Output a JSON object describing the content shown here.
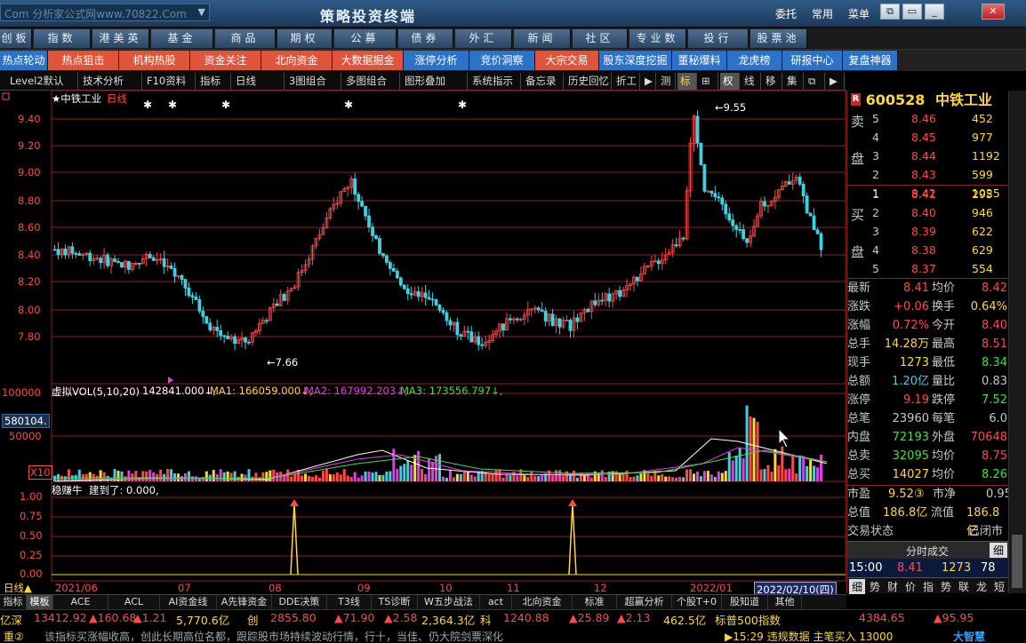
{
  "title_bar": {
    "search_text": "Com  分析家公式网www.70822.Com",
    "app_title": "策略投资终端",
    "menu": [
      "委托",
      "常用",
      "菜单"
    ],
    "win_buttons": [
      "⧉",
      "▭",
      "_",
      "✕"
    ]
  },
  "menubar": [
    "创板",
    "指数",
    "港美英",
    "基金",
    "商品",
    "期权",
    "公募REITs",
    "债券",
    "外汇",
    "新闻",
    "社区",
    "专业数据",
    "投行",
    "股票池"
  ],
  "tabbar": [
    {
      "label": "热点轮动",
      "color": "#2b73c9"
    },
    {
      "label": "热点狙击",
      "color": "#e0553a"
    },
    {
      "label": "机构热股",
      "color": "#e0553a"
    },
    {
      "label": "资金关注",
      "color": "#e0553a"
    },
    {
      "label": "北向资金",
      "color": "#e0553a"
    },
    {
      "label": "大数据掘金",
      "color": "#e0553a"
    },
    {
      "label": "涨停分析",
      "color": "#2b73c9"
    },
    {
      "label": "竞价洞察",
      "color": "#2b73c9"
    },
    {
      "label": "大宗交易",
      "color": "#e0553a"
    },
    {
      "label": "股东深度挖掘",
      "color": "#2b73c9"
    },
    {
      "label": "董秘爆料",
      "color": "#2b73c9"
    },
    {
      "label": "龙虎榜",
      "color": "#2b73c9"
    },
    {
      "label": "研报中心",
      "color": "#2b73c9"
    },
    {
      "label": "复盘神器",
      "color": "#2b73c9"
    }
  ],
  "toolbar": [
    "Level2默认",
    "技术分析",
    "F10资料",
    "指标",
    "日线",
    "3图组合",
    "多图组合",
    "图形叠加",
    "系统指示",
    "备忘录",
    "历史回忆",
    "折工",
    "▶",
    "测",
    "标",
    "⊞",
    "权",
    "线",
    "移",
    "集",
    "⧉",
    "▶"
  ],
  "chart": {
    "stock_label": "★中铁工业",
    "period_label": "日线",
    "price_ticks": [
      "9.40",
      "9.20",
      "9.00",
      "8.80",
      "8.60",
      "8.40",
      "8.20",
      "8.00",
      "7.80"
    ],
    "high_marker": "9.55",
    "low_marker": "7.66",
    "vol_header": "虚拟VOL(5,10,20)",
    "vol_value": "142841.000↓,",
    "ma1": "MA1: 166059.000↓,",
    "ma2": "MA2: 167992.203↓,",
    "ma3": "MA3: 173556.797↓,",
    "vol_ticks": [
      "100000",
      "50000"
    ],
    "vol_box": "580104.",
    "vol_mult": "X10",
    "ind_name": "稳赚牛",
    "ind_text": "建到了: 0.000,",
    "ind_ticks": [
      "1.00",
      "0.75",
      "0.50",
      "0.25",
      "0.00"
    ],
    "period_bottom": "日线▲",
    "dates": [
      "2021/06",
      "07",
      "08",
      "09",
      "10",
      "11",
      "12",
      "2022/01"
    ],
    "date_box": "2022/02/10(四)",
    "colors": {
      "up": "#ff4a4a",
      "down": "#40d0e0",
      "grid": "#8a2020",
      "ma1": "#ffffff",
      "ma2": "#e040e0",
      "ma3": "#40e040"
    }
  },
  "chart_data": {
    "type": "candlestick",
    "title": "中铁工业",
    "ylim": [
      7.6,
      9.6
    ],
    "x_labels": [
      "2021/06",
      "07",
      "08",
      "09",
      "10",
      "11",
      "12",
      "2022/01",
      "2022/02/10"
    ],
    "high": 9.55,
    "low": 7.66,
    "close_last": 8.41,
    "grid": true
  },
  "right_panel": {
    "code": "600528",
    "name": "中铁工业",
    "sell_label": [
      "卖",
      "盘"
    ],
    "buy_label": [
      "买",
      "盘"
    ],
    "sell": [
      {
        "lvl": "5",
        "price": "8.46",
        "vol": "452"
      },
      {
        "lvl": "4",
        "price": "8.45",
        "vol": "977"
      },
      {
        "lvl": "3",
        "price": "8.44",
        "vol": "1192"
      },
      {
        "lvl": "2",
        "price": "8.43",
        "vol": "599"
      },
      {
        "lvl": "1",
        "price": "8.42",
        "vol": "1025"
      }
    ],
    "buy": [
      {
        "lvl": "1",
        "price": "8.41",
        "vol": "295"
      },
      {
        "lvl": "2",
        "price": "8.40",
        "vol": "946"
      },
      {
        "lvl": "3",
        "price": "8.39",
        "vol": "622"
      },
      {
        "lvl": "4",
        "price": "8.38",
        "vol": "629"
      },
      {
        "lvl": "5",
        "price": "8.37",
        "vol": "554"
      }
    ],
    "quotes": [
      {
        "k1": "最新",
        "v1": "8.41",
        "c1": "#ff4a4a",
        "k2": "均价",
        "v2": "8.42",
        "c2": "#ff4a4a"
      },
      {
        "k1": "涨跌",
        "v1": "+0.06",
        "c1": "#ff4a4a",
        "k2": "换手",
        "v2": "0.64%",
        "c2": "#ffd83a"
      },
      {
        "k1": "涨幅",
        "v1": "0.72%",
        "c1": "#ff4a4a",
        "k2": "今开",
        "v2": "8.40",
        "c2": "#ff4a4a"
      },
      {
        "k1": "总手",
        "v1": "14.28万",
        "c1": "#ffd83a",
        "k2": "最高",
        "v2": "8.51",
        "c2": "#ff4a4a"
      },
      {
        "k1": "现手",
        "v1": "1273",
        "c1": "#ffd83a",
        "k2": "最低",
        "v2": "8.34",
        "c2": "#40e040"
      },
      {
        "k1": "总额",
        "v1": "1.20亿",
        "c1": "#40d0e0",
        "k2": "量比",
        "v2": "0.83",
        "c2": "#c8c8c8"
      },
      {
        "k1": "涨停",
        "v1": "9.19",
        "c1": "#ff4a4a",
        "k2": "跌停",
        "v2": "7.52",
        "c2": "#40e040"
      },
      {
        "k1": "总笔",
        "v1": "23960",
        "c1": "#c8c8c8",
        "k2": "每笔",
        "v2": "6.0",
        "c2": "#c8c8c8"
      },
      {
        "k1": "内盘",
        "v1": "72193",
        "c1": "#40e040",
        "k2": "外盘",
        "v2": "70648",
        "c2": "#ff4a4a"
      },
      {
        "k1": "总卖",
        "v1": "32095",
        "c1": "#40e040",
        "k2": "均价",
        "v2": "8.75",
        "c2": "#ff4a4a"
      },
      {
        "k1": "总买",
        "v1": "14027",
        "c1": "#ffd83a",
        "k2": "均价",
        "v2": "8.26",
        "c2": "#40e040"
      }
    ],
    "pe": {
      "k1": "市盈",
      "v1": "9.52③",
      "k2": "市净",
      "v2": "0.95"
    },
    "cap": {
      "k1": "总值",
      "v1": "186.8亿",
      "k2": "流值",
      "v2": "186.8亿"
    },
    "status": {
      "k": "交易状态",
      "v": "已闭市"
    },
    "trades_tab": "分时成交",
    "detail_tab": "细",
    "trade": {
      "time": "15:00",
      "price": "8.41",
      "vol": "1273",
      "n": "78"
    },
    "bottom_tabs": [
      "细",
      "势",
      "财",
      "价",
      "指",
      "势",
      "联",
      "龙",
      "短"
    ]
  },
  "bottom_bar": [
    "指标",
    "模板",
    "ACE",
    "ACL",
    "AI资金线",
    "A先锋资金",
    "DDE决策",
    "T3线",
    "TS诊断",
    "W五步战法",
    "act",
    "北向资金",
    "标准",
    "超赢分析",
    "个股T+0",
    "股知道",
    "其他"
  ],
  "ticker": [
    {
      "t": "亿深",
      "c": "#ffd83a"
    },
    {
      "t": "13412.92",
      "c": "#ff4a4a"
    },
    {
      "t": "▲160.68",
      "c": "#ff4a4a"
    },
    {
      "t": "▲1.21",
      "c": "#ff4a4a"
    },
    {
      "t": "5,770.6亿",
      "c": "#ffd83a"
    },
    {
      "t": "创",
      "c": "#ffd83a"
    },
    {
      "t": "2855.80",
      "c": "#ff4a4a"
    },
    {
      "t": "▲71.90",
      "c": "#ff4a4a"
    },
    {
      "t": "▲2.58",
      "c": "#ff4a4a"
    },
    {
      "t": "2,364.3亿",
      "c": "#ffd83a"
    },
    {
      "t": "科",
      "c": "#ffd83a"
    },
    {
      "t": "1240.88",
      "c": "#ff4a4a"
    },
    {
      "t": "▲25.89",
      "c": "#ff4a4a"
    },
    {
      "t": "▲2.13",
      "c": "#ff4a4a"
    },
    {
      "t": "462.5亿",
      "c": "#ffd83a"
    },
    {
      "t": "标普500指数",
      "c": "#ffd83a"
    },
    {
      "t": "4384.65",
      "c": "#ff4a4a"
    },
    {
      "t": "▲95.95",
      "c": "#ff4a4a"
    }
  ],
  "footer": {
    "left": "重②",
    "text": "该指标买涨幅收高，创此长期高位名都，跟踪股市场持续波动行情，行十，当佳、仍大院剑票深化",
    "right_tag": "▶15:29 违规数据 主笔买入 13000",
    "brand": "大智慧"
  }
}
